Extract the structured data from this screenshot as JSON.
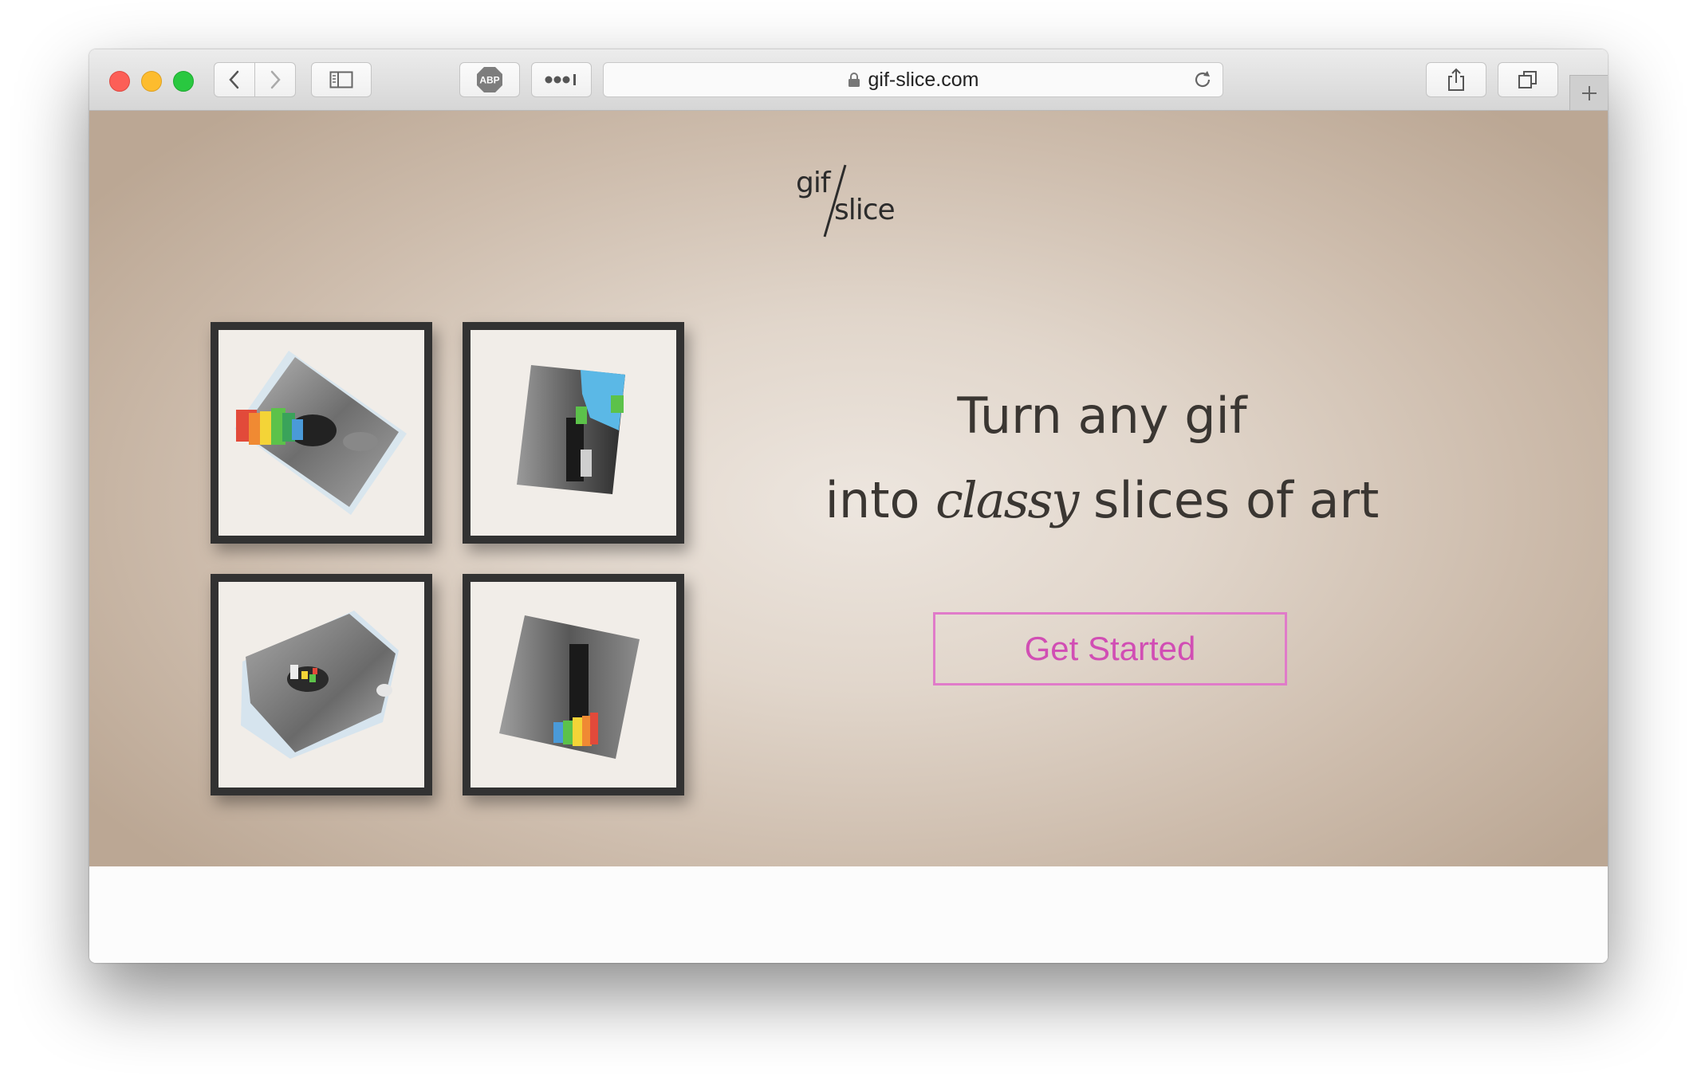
{
  "browser": {
    "url": "gif-slice.com",
    "buttons": {
      "back": "chevron-left-icon",
      "forward": "chevron-right-icon",
      "sidebar": "sidebar-icon",
      "adblock": "ABP",
      "extensions": "more-dots-icon",
      "reload": "reload-icon",
      "share": "share-icon",
      "tabs": "tabs-overview-icon",
      "new_tab": "plus-icon"
    }
  },
  "logo": {
    "top": "gif",
    "bottom": "slice"
  },
  "hero": {
    "line1": "Turn any gif",
    "line2_before": "into ",
    "line2_emphasis": "classy",
    "line2_after": " slices of art",
    "cta_label": "Get Started"
  },
  "colors": {
    "accent": "#e07bc9",
    "cta_text": "#d14eb4",
    "frame": "#323232",
    "text": "#3a3632"
  }
}
